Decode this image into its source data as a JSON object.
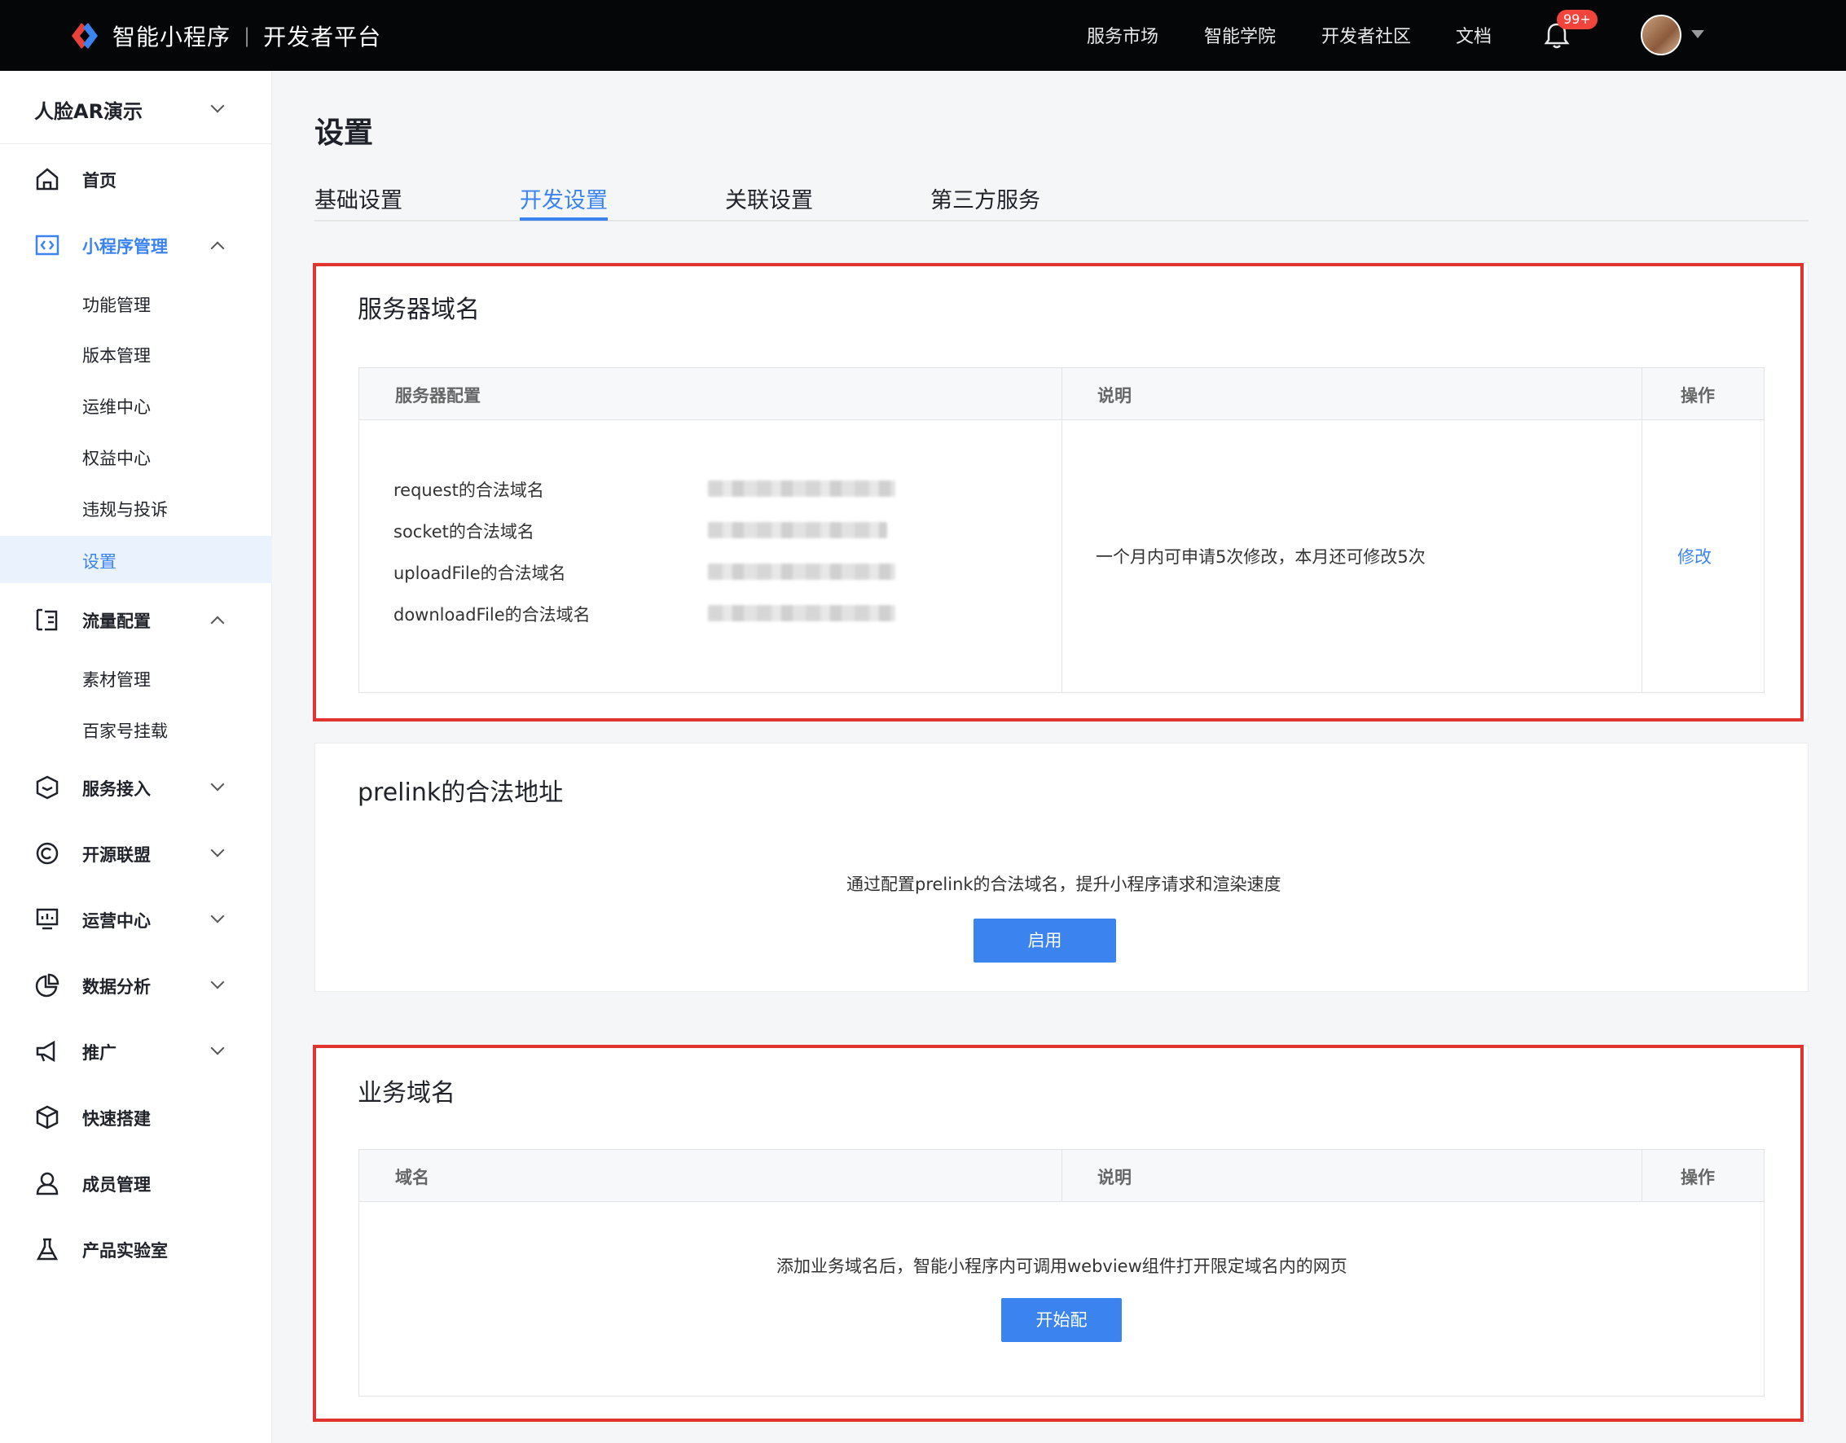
{
  "topbar": {
    "brand": "智能小程序",
    "separator": "|",
    "platform": "开发者平台",
    "nav": [
      "服务市场",
      "智能学院",
      "开发者社区",
      "文档"
    ],
    "notification_count": "99+",
    "icons": {
      "logo": "swan-logo-icon",
      "bell": "bell-icon",
      "avatar": "user-avatar",
      "caret": "caret-down-icon"
    }
  },
  "sidebar": {
    "app_name": "人脸AR演示",
    "items": [
      {
        "label": "首页",
        "icon": "home-icon"
      },
      {
        "label": "小程序管理",
        "icon": "code-window-icon",
        "expanded": true,
        "children": [
          "功能管理",
          "版本管理",
          "运维中心",
          "权益中心",
          "违规与投诉",
          "设置"
        ]
      },
      {
        "label": "流量配置",
        "icon": "list-icon",
        "expanded": true,
        "children": [
          "素材管理",
          "百家号挂载"
        ]
      },
      {
        "label": "服务接入",
        "icon": "box-icon"
      },
      {
        "label": "开源联盟",
        "icon": "circle-c-icon"
      },
      {
        "label": "运营中心",
        "icon": "monitor-icon"
      },
      {
        "label": "数据分析",
        "icon": "pie-icon"
      },
      {
        "label": "推广",
        "icon": "megaphone-icon"
      },
      {
        "label": "快速搭建",
        "icon": "cube-icon"
      },
      {
        "label": "成员管理",
        "icon": "user-icon"
      },
      {
        "label": "产品实验室",
        "icon": "flask-icon"
      }
    ],
    "selected": "设置",
    "accent": "#3b84f0"
  },
  "main": {
    "title": "设置",
    "tabs": [
      "基础设置",
      "开发设置",
      "关联设置",
      "第三方服务"
    ],
    "active_tab": "开发设置",
    "server_domain": {
      "title": "服务器域名",
      "headers": [
        "服务器配置",
        "说明",
        "操作"
      ],
      "rows": [
        "request的合法域名",
        "socket的合法域名",
        "uploadFile的合法域名",
        "downloadFile的合法域名"
      ],
      "description": "一个月内可申请5次修改，本月还可修改5次",
      "action": "修改"
    },
    "prelink": {
      "title": "prelink的合法地址",
      "description": "通过配置prelink的合法域名，提升小程序请求和渲染速度",
      "button": "启用"
    },
    "business_domain": {
      "title": "业务域名",
      "headers": [
        "域名",
        "说明",
        "操作"
      ],
      "description": "添加业务域名后，智能小程序内可调用webview组件打开限定域名内的网页",
      "button": "开始配"
    },
    "highlight_color": "#e2342f"
  }
}
